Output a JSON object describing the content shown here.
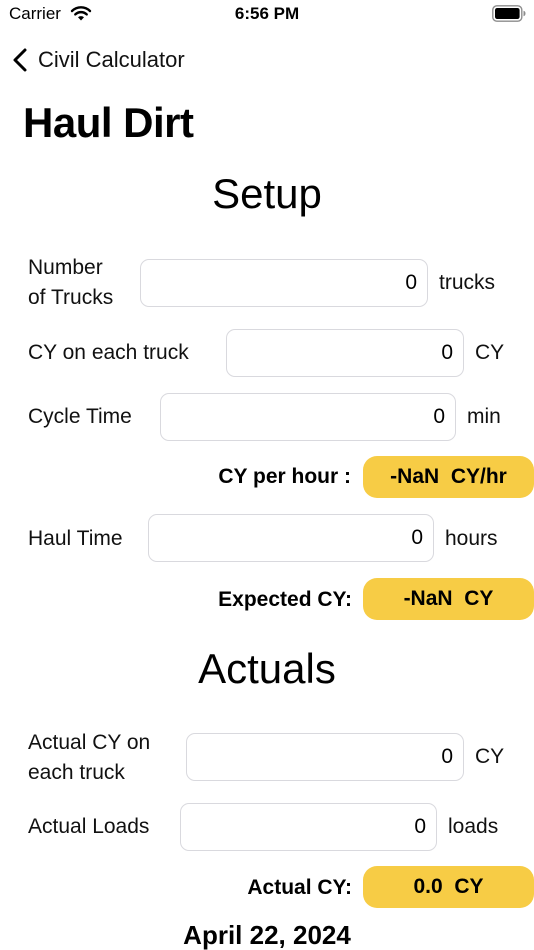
{
  "status_bar": {
    "carrier": "Carrier",
    "time": "6:56 PM"
  },
  "nav": {
    "back_label": "Civil Calculator",
    "title": "Haul Dirt"
  },
  "setup": {
    "title": "Setup",
    "trucks_label_line1": "Number",
    "trucks_label_line2": "of Trucks",
    "trucks_value": "0",
    "trucks_unit": "trucks",
    "cy_truck_label": "CY on each truck",
    "cy_truck_value": "0",
    "cy_truck_unit": "CY",
    "cycle_label": "Cycle Time",
    "cycle_value": "0",
    "cycle_unit": "min",
    "cy_per_hour_label": "CY per hour :",
    "cy_per_hour_value": "-NaN  CY/hr",
    "haul_label": "Haul Time",
    "haul_value": "0",
    "haul_unit": "hours",
    "expected_label": "Expected CY:",
    "expected_value": "-NaN  CY"
  },
  "actuals": {
    "title": "Actuals",
    "actual_cy_label_line1": "Actual CY on",
    "actual_cy_label_line2": "each truck",
    "actual_cy_value": "0",
    "actual_cy_unit": "CY",
    "loads_label": "Actual Loads",
    "loads_value": "0",
    "loads_unit": "loads",
    "actual_total_label": "Actual CY:",
    "actual_total_value": "0.0  CY"
  },
  "date": "April 22, 2024",
  "colors": {
    "accent_badge": "#f7cc45",
    "field_border": "#d9d9de"
  }
}
